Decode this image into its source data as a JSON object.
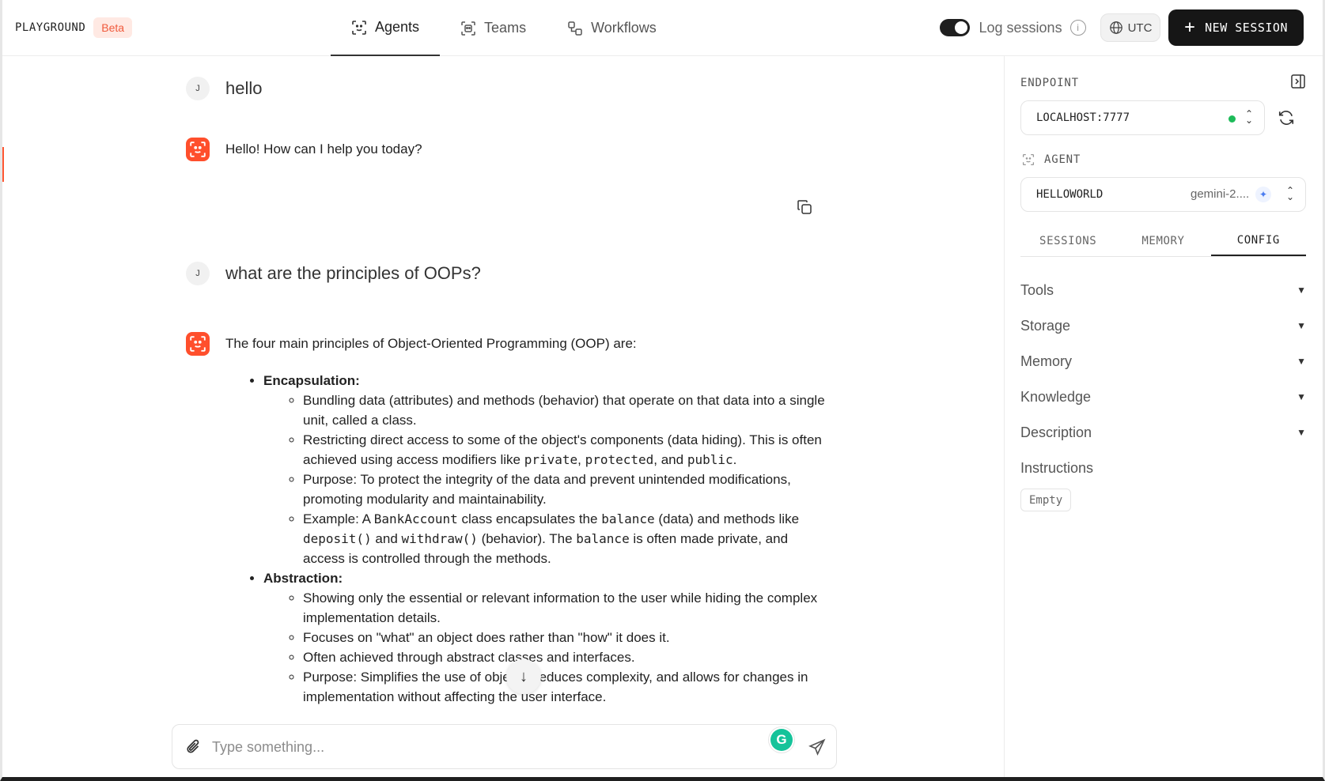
{
  "header": {
    "app_title": "PLAYGROUND",
    "badge": "Beta",
    "tabs": [
      {
        "label": "Agents",
        "icon": "agent-scan-icon",
        "active": true
      },
      {
        "label": "Teams",
        "icon": "team-icon",
        "active": false
      },
      {
        "label": "Workflows",
        "icon": "workflow-icon",
        "active": false
      }
    ],
    "log_sessions_label": "Log sessions",
    "log_sessions_enabled": true,
    "timezone": "UTC",
    "new_session_label": "NEW SESSION"
  },
  "chat": {
    "user_initial": "J",
    "messages": [
      {
        "role": "user",
        "text": "hello"
      },
      {
        "role": "assistant",
        "text": "Hello! How can I help you today?"
      },
      {
        "role": "user",
        "text": "what are the principles of OOPs?"
      },
      {
        "role": "assistant",
        "text": "The four main principles of Object-Oriented Programming (OOP) are:"
      }
    ],
    "answer": {
      "encapsulation": {
        "title": "Encapsulation:",
        "b1": "Bundling data (attributes) and methods (behavior) that operate on that data into a single unit, called a class.",
        "b2_pre": "Restricting direct access to some of the object's components (data hiding). This is often achieved using access modifiers like ",
        "b2_c1": "private",
        "b2_sep1": ", ",
        "b2_c2": "protected",
        "b2_sep2": ", and ",
        "b2_c3": "public",
        "b2_end": ".",
        "b3": "Purpose: To protect the integrity of the data and prevent unintended modifications, promoting modularity and maintainability.",
        "b4_pre": "Example: A ",
        "b4_c1": "BankAccount",
        "b4_t1": " class encapsulates the ",
        "b4_c2": "balance",
        "b4_t2": " (data) and methods like ",
        "b4_c3": "deposit()",
        "b4_t3": " and ",
        "b4_c4": "withdraw()",
        "b4_t4": " (behavior). The ",
        "b4_c5": "balance",
        "b4_t5": " is often made private, and access is controlled through the methods."
      },
      "abstraction": {
        "title": "Abstraction:",
        "b1": "Showing only the essential or relevant information to the user while hiding the complex implementation details.",
        "b2": "Focuses on \"what\" an object does rather than \"how\" it does it.",
        "b3": "Often achieved through abstract classes and interfaces.",
        "b4": "Purpose: Simplifies the use of objects, reduces complexity, and allows for changes in implementation without affecting the user interface."
      }
    },
    "input_placeholder": "Type something..."
  },
  "panel": {
    "endpoint_label": "ENDPOINT",
    "endpoint_value": "LOCALHOST:7777",
    "endpoint_status_color": "#1dbb59",
    "agent_label": "AGENT",
    "agent_name": "HELLOWORLD",
    "agent_model": "gemini-2....",
    "tabs": [
      {
        "label": "SESSIONS",
        "active": false
      },
      {
        "label": "MEMORY",
        "active": false
      },
      {
        "label": "CONFIG",
        "active": true
      }
    ],
    "config_items": [
      {
        "label": "Tools",
        "expandable": true
      },
      {
        "label": "Storage",
        "expandable": true
      },
      {
        "label": "Memory",
        "expandable": true
      },
      {
        "label": "Knowledge",
        "expandable": true
      },
      {
        "label": "Description",
        "expandable": true
      },
      {
        "label": "Instructions",
        "expandable": false
      }
    ],
    "instructions_value": "Empty"
  },
  "colors": {
    "accent": "#ff4f2c",
    "button_dark": "#161616",
    "status_green": "#1dbb59"
  }
}
